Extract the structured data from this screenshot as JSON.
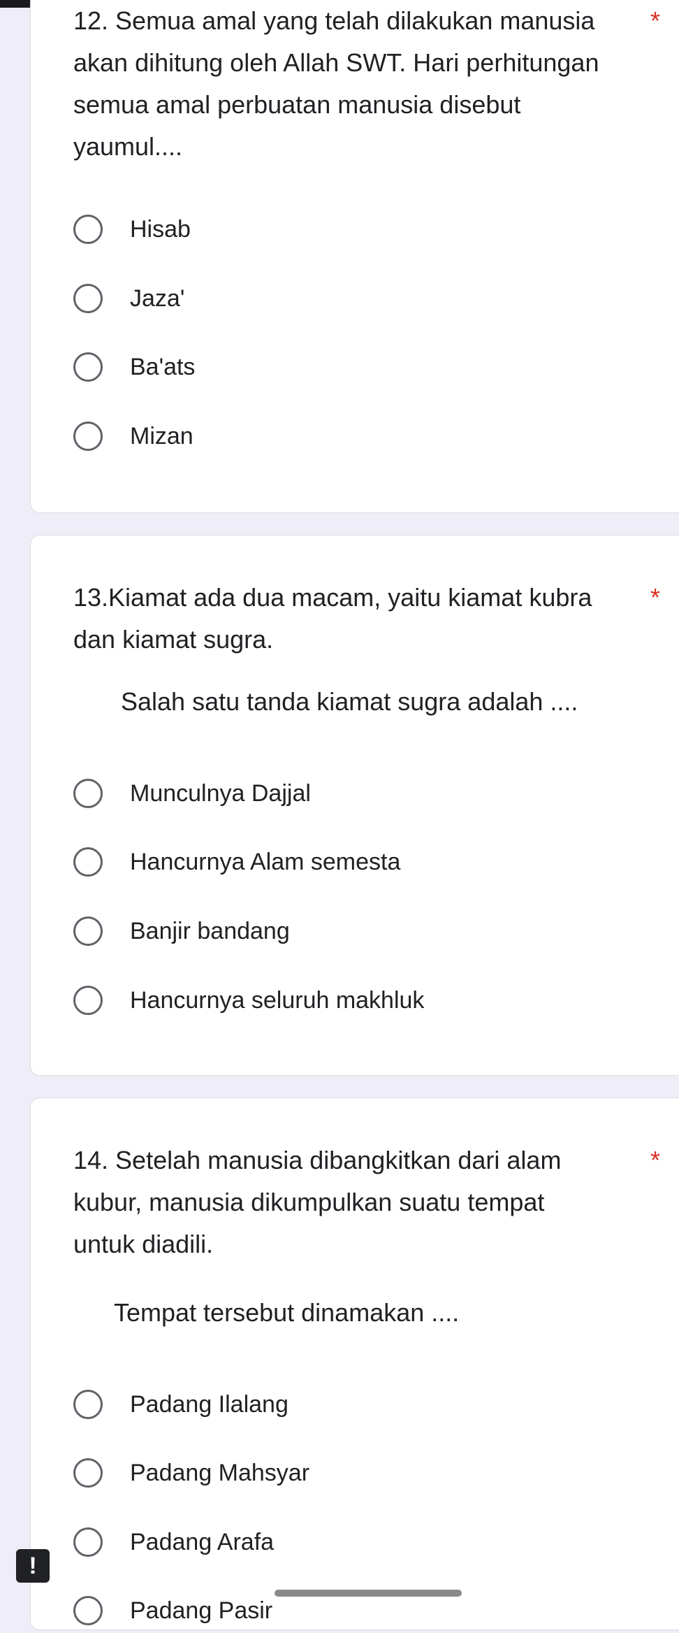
{
  "questions": [
    {
      "text_lines": [
        "12. Semua amal yang telah dilakukan manusia",
        "akan dihitung oleh Allah SWT. Hari perhitungan",
        "semua amal perbuatan manusia disebut",
        "yaumul...."
      ],
      "required_mark": "*",
      "subprompt": "",
      "options": [
        "Hisab",
        "Jaza'",
        "Ba'ats",
        "Mizan"
      ]
    },
    {
      "text_lines": [
        "13.Kiamat ada dua macam, yaitu kiamat kubra",
        "dan kiamat sugra."
      ],
      "required_mark": "*",
      "subprompt": "Salah satu tanda kiamat sugra adalah ....",
      "options": [
        "Munculnya Dajjal",
        "Hancurnya Alam semesta",
        "Banjir bandang",
        "Hancurnya seluruh makhluk"
      ]
    },
    {
      "text_lines": [
        "14. Setelah manusia dibangkitkan dari alam",
        "kubur, manusia dikumpulkan suatu tempat",
        "untuk diadili."
      ],
      "required_mark": "*",
      "subprompt": "Tempat tersebut dinamakan ....",
      "options": [
        "Padang Ilalang",
        "Padang Mahsyar",
        "Padang Arafa",
        "Padang Pasir"
      ]
    }
  ],
  "report_button": {
    "label": "!"
  },
  "colors": {
    "accent_required": "#d93025",
    "background": "#efedf7",
    "card": "#ffffff"
  }
}
